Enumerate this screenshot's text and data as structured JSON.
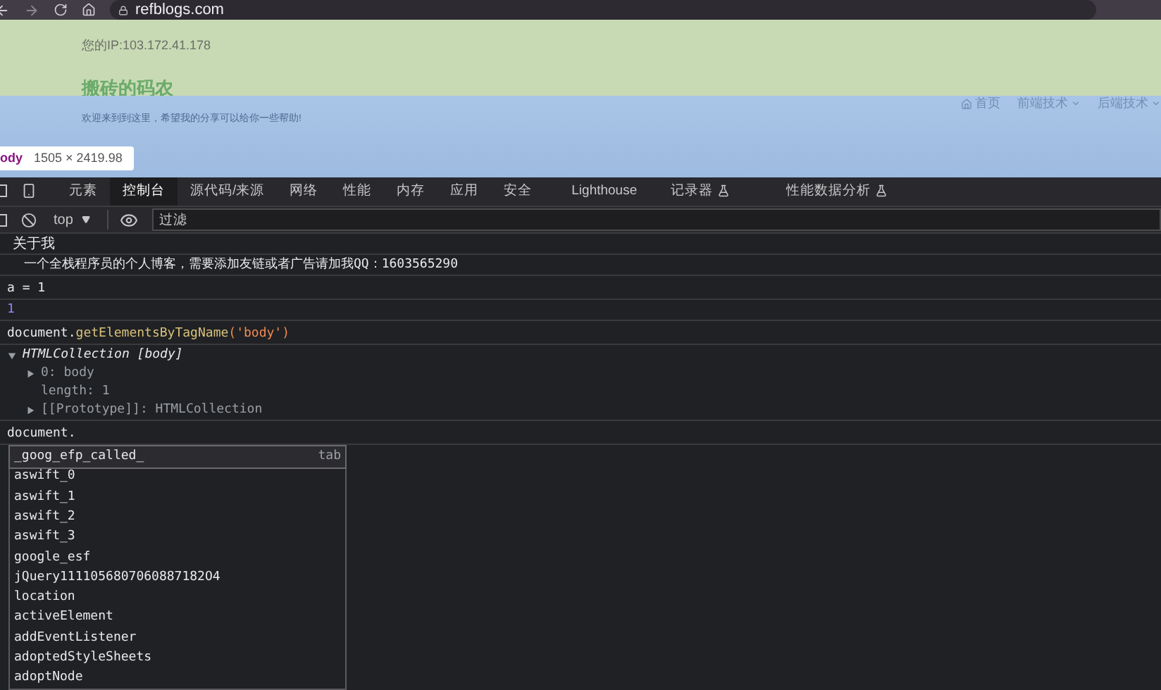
{
  "browser": {
    "url": "refblogs.com"
  },
  "page": {
    "ip": "您的IP:103.172.41.178",
    "site_title": "搬砖的码农",
    "tagline": "欢迎来到到这里，希望我的分享可以给你一些帮助!",
    "nav": [
      {
        "label": "首页",
        "dropdown": false
      },
      {
        "label": "前端技术",
        "dropdown": true
      },
      {
        "label": "后端技术",
        "dropdown": true
      }
    ],
    "tooltip": {
      "tag": "ody",
      "size": "1505 × 2419.98"
    }
  },
  "devtools": {
    "tabs": [
      {
        "label": "元素",
        "selected": false,
        "experimental": false
      },
      {
        "label": "控制台",
        "selected": true,
        "experimental": false
      },
      {
        "label": "源代码/来源",
        "selected": false,
        "experimental": false
      },
      {
        "label": "网络",
        "selected": false,
        "experimental": false
      },
      {
        "label": "性能",
        "selected": false,
        "experimental": false
      },
      {
        "label": "内存",
        "selected": false,
        "experimental": false
      },
      {
        "label": "应用",
        "selected": false,
        "experimental": false
      },
      {
        "label": "安全",
        "selected": false,
        "experimental": false
      },
      {
        "label": "Lighthouse",
        "selected": false,
        "experimental": false
      },
      {
        "label": "记录器",
        "selected": false,
        "experimental": true
      },
      {
        "label": "性能数据分析",
        "selected": false,
        "experimental": true
      }
    ],
    "context": "top",
    "filter": {
      "placeholder": "过滤"
    },
    "console": [
      {
        "kind": "group",
        "text": "关于我"
      },
      {
        "kind": "log",
        "text": "一个全栈程序员的个人博客，需要添加友链或者广告请加我QQ：1603565290"
      },
      {
        "kind": "input",
        "text": "a =  1"
      },
      {
        "kind": "result",
        "text": "1"
      },
      {
        "kind": "call",
        "object": "document.",
        "method": "getElementsByTagName",
        "arg": "('body')"
      },
      {
        "kind": "tree",
        "text": "HTMLCollection [body]",
        "expanded": true,
        "children": [
          {
            "text": "0: body",
            "expandable": true
          },
          {
            "text": "length: 1",
            "expandable": false
          },
          {
            "text": "[[Prototype]]: HTMLCollection",
            "expandable": true
          }
        ]
      },
      {
        "kind": "input",
        "text": "document."
      }
    ],
    "autocomplete": {
      "hint": "tab",
      "items": [
        {
          "text": "_goog_efp_called_",
          "selected": true
        },
        {
          "text": "aswift_0",
          "selected": false
        },
        {
          "text": "aswift_1",
          "selected": false
        },
        {
          "text": "aswift_2",
          "selected": false
        },
        {
          "text": "aswift_3",
          "selected": false
        },
        {
          "text": "google_esf",
          "selected": false
        },
        {
          "text": "jQuery1111056807060887182O4",
          "selected": false
        },
        {
          "text": "location",
          "selected": false
        },
        {
          "text": "activeElement",
          "selected": false
        },
        {
          "text": "addEventListener",
          "selected": false
        },
        {
          "text": "adoptedStyleSheets",
          "selected": false
        },
        {
          "text": "adoptNode",
          "selected": false
        }
      ]
    }
  }
}
